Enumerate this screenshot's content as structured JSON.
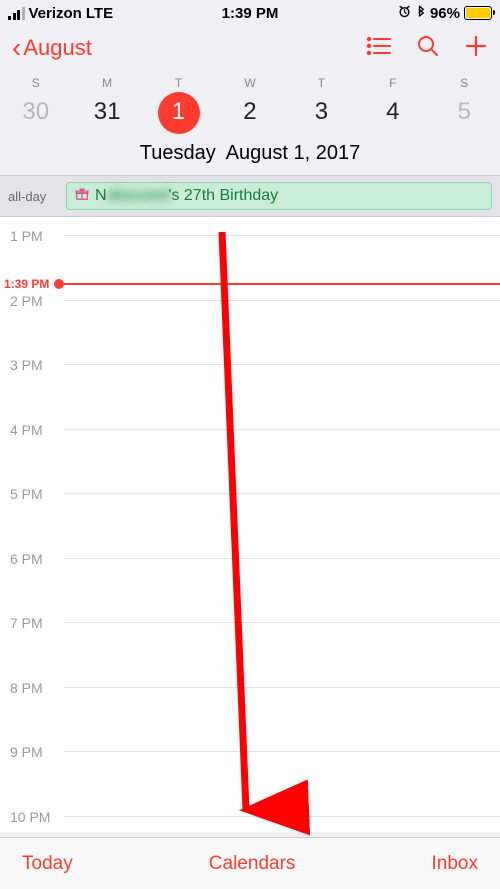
{
  "status": {
    "carrier": "Verizon",
    "network": "LTE",
    "time": "1:39 PM",
    "alarm_icon": "⏰",
    "bluetooth_icon": "✱",
    "battery_pct": "96%"
  },
  "nav": {
    "back_label": "August"
  },
  "week": {
    "labels": [
      "S",
      "M",
      "T",
      "W",
      "T",
      "F",
      "S"
    ],
    "days": [
      "30",
      "31",
      "1",
      "2",
      "3",
      "4",
      "5"
    ],
    "selected_index": 2,
    "dim_indices": [
      0,
      6
    ]
  },
  "date_title": {
    "dow": "Tuesday",
    "full": "August 1, 2017"
  },
  "allday": {
    "label": "all-day",
    "event_prefix": "N",
    "event_blur": "obscured",
    "event_suffix": "'s 27th Birthday"
  },
  "hours": [
    "1 PM",
    "2 PM",
    "3 PM",
    "4 PM",
    "5 PM",
    "6 PM",
    "7 PM",
    "8 PM",
    "9 PM",
    "10 PM"
  ],
  "now": {
    "label": "1:39 PM"
  },
  "toolbar": {
    "today": "Today",
    "calendars": "Calendars",
    "inbox": "Inbox"
  },
  "colors": {
    "accent": "#ff3b30"
  }
}
